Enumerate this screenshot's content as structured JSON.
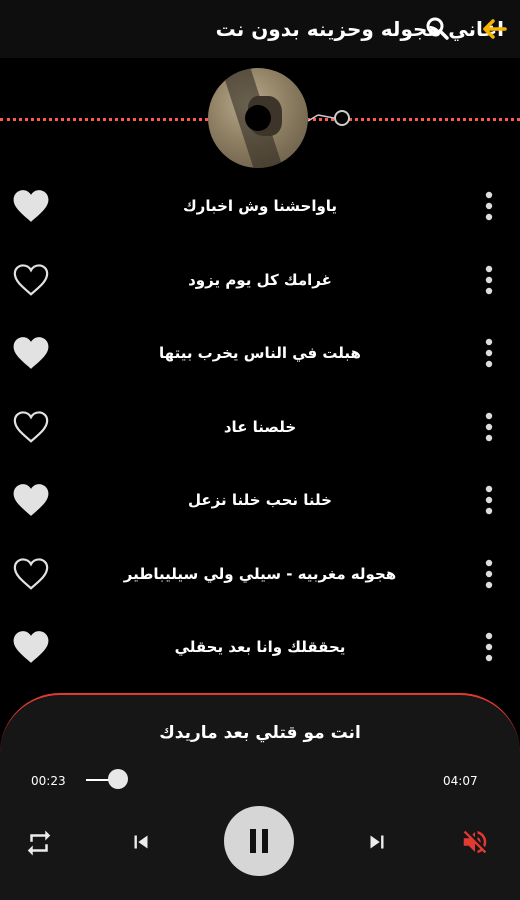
{
  "app_bar": {
    "title": "اغاني هجوله وحزينه بدون نت",
    "search_icon": "search-icon",
    "back_icon": "arrow-left-icon",
    "back_color": "#f5b400"
  },
  "colors": {
    "accent": "#e23a32",
    "progress_dots": "#ff5a4e",
    "background": "#000000",
    "player_bg": "#161616"
  },
  "songs": [
    {
      "title": "ياواحشنا وش اخبارك",
      "favorite": true
    },
    {
      "title": "غرامك كل يوم يزود",
      "favorite": false
    },
    {
      "title": "هبلت في الناس يخرب بيتها",
      "favorite": true
    },
    {
      "title": "خلصنا عاد",
      "favorite": false
    },
    {
      "title": "خلنا نحب خلنا نزعل",
      "favorite": true
    },
    {
      "title": "هجوله مغربيه - سيلي ولي سيليباطير",
      "favorite": false
    },
    {
      "title": "يحققلك وانا بعد يحقلي",
      "favorite": true
    }
  ],
  "player": {
    "now_playing": "انت مو قتلي بعد ماريدك",
    "current_time": "00:23",
    "total_time": "04:07",
    "progress": 0.093,
    "state": "playing",
    "muted": true
  }
}
